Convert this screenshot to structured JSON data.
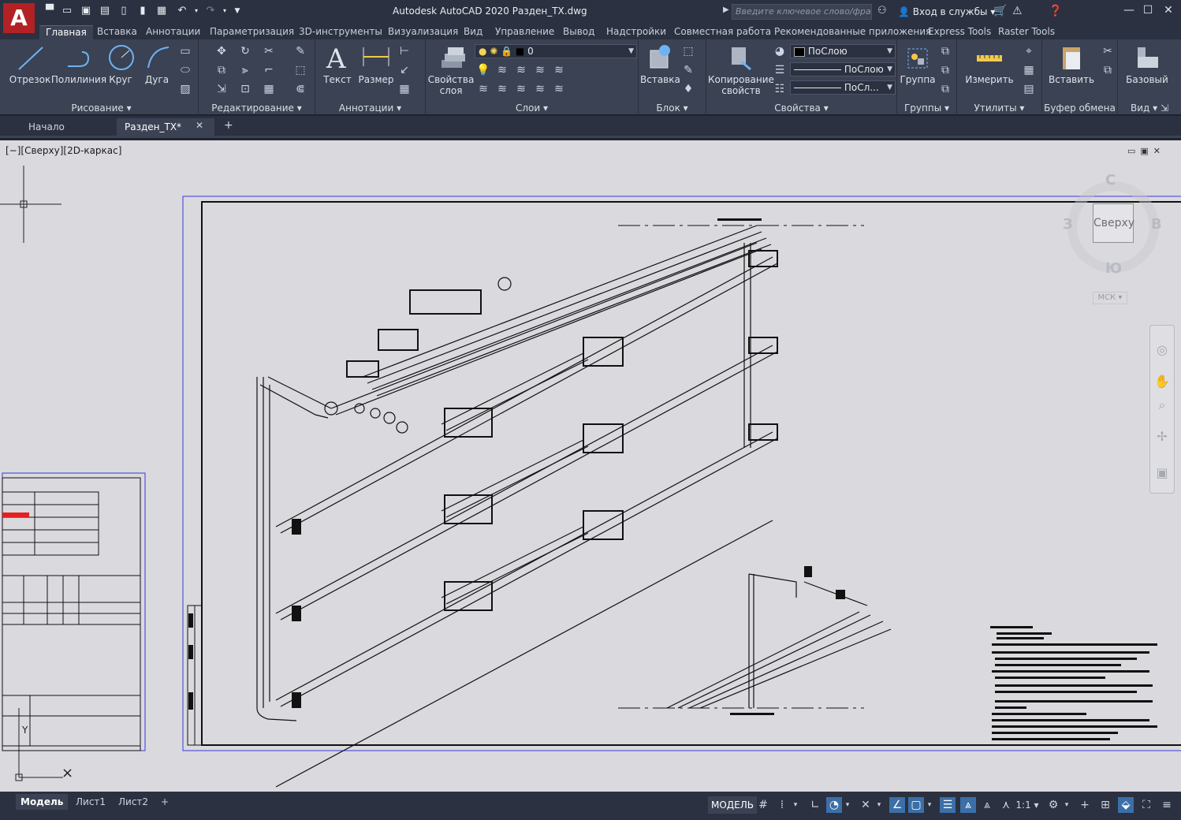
{
  "app": {
    "logo": "A",
    "title": "Autodesk AutoCAD 2020    Разден_TX.dwg",
    "search_placeholder": "Введите ключевое слово/фразу",
    "signin": "Вход в службы"
  },
  "ribbon_tabs": [
    "Главная",
    "Вставка",
    "Аннотации",
    "Параметризация",
    "3D-инструменты",
    "Визуализация",
    "Вид",
    "Управление",
    "Вывод",
    "Надстройки",
    "Совместная работа",
    "Рекомендованные приложения",
    "Express Tools",
    "Raster Tools"
  ],
  "panels": {
    "draw": {
      "label": "Рисование",
      "buttons": [
        "Отрезок",
        "Полилиния",
        "Круг",
        "Дуга"
      ]
    },
    "modify": {
      "label": "Редактирование"
    },
    "annotation": {
      "label": "Аннотации",
      "buttons": [
        "Текст",
        "Размер"
      ]
    },
    "layers": {
      "label": "Слои",
      "button": "Свойства\nслоя",
      "layer_value": "0"
    },
    "block": {
      "label": "Блок",
      "button": "Вставка"
    },
    "properties": {
      "label": "Свойства",
      "button": "Копирование\nсвойств",
      "color": "ПоСлою",
      "linetype": "ПоСлою",
      "lineweight": "ПоСл..."
    },
    "groups": {
      "label": "Группы",
      "button": "Группа"
    },
    "utilities": {
      "label": "Утилиты",
      "button": "Измерить"
    },
    "clipboard": {
      "label": "Буфер обмена",
      "button": "Вставить"
    },
    "view": {
      "label": "Вид",
      "button": "Базовый"
    }
  },
  "file_tabs": [
    "Начало",
    "Разден_TX*"
  ],
  "viewport_label": "[−][Сверху][2D-каркас]",
  "viewcube": {
    "top": "Сверху",
    "north": "С",
    "south": "Ю",
    "west": "З",
    "east": "В",
    "wcs": "МСК"
  },
  "layout_tabs": [
    "Модель",
    "Лист1",
    "Лист2"
  ],
  "status": {
    "model": "МОДЕЛЬ",
    "scale": "1:1"
  },
  "colors": {
    "accent": "#3c6fa8",
    "logo": "#b22124",
    "canvas": "#dad9de",
    "frame": "#3a38d8"
  }
}
